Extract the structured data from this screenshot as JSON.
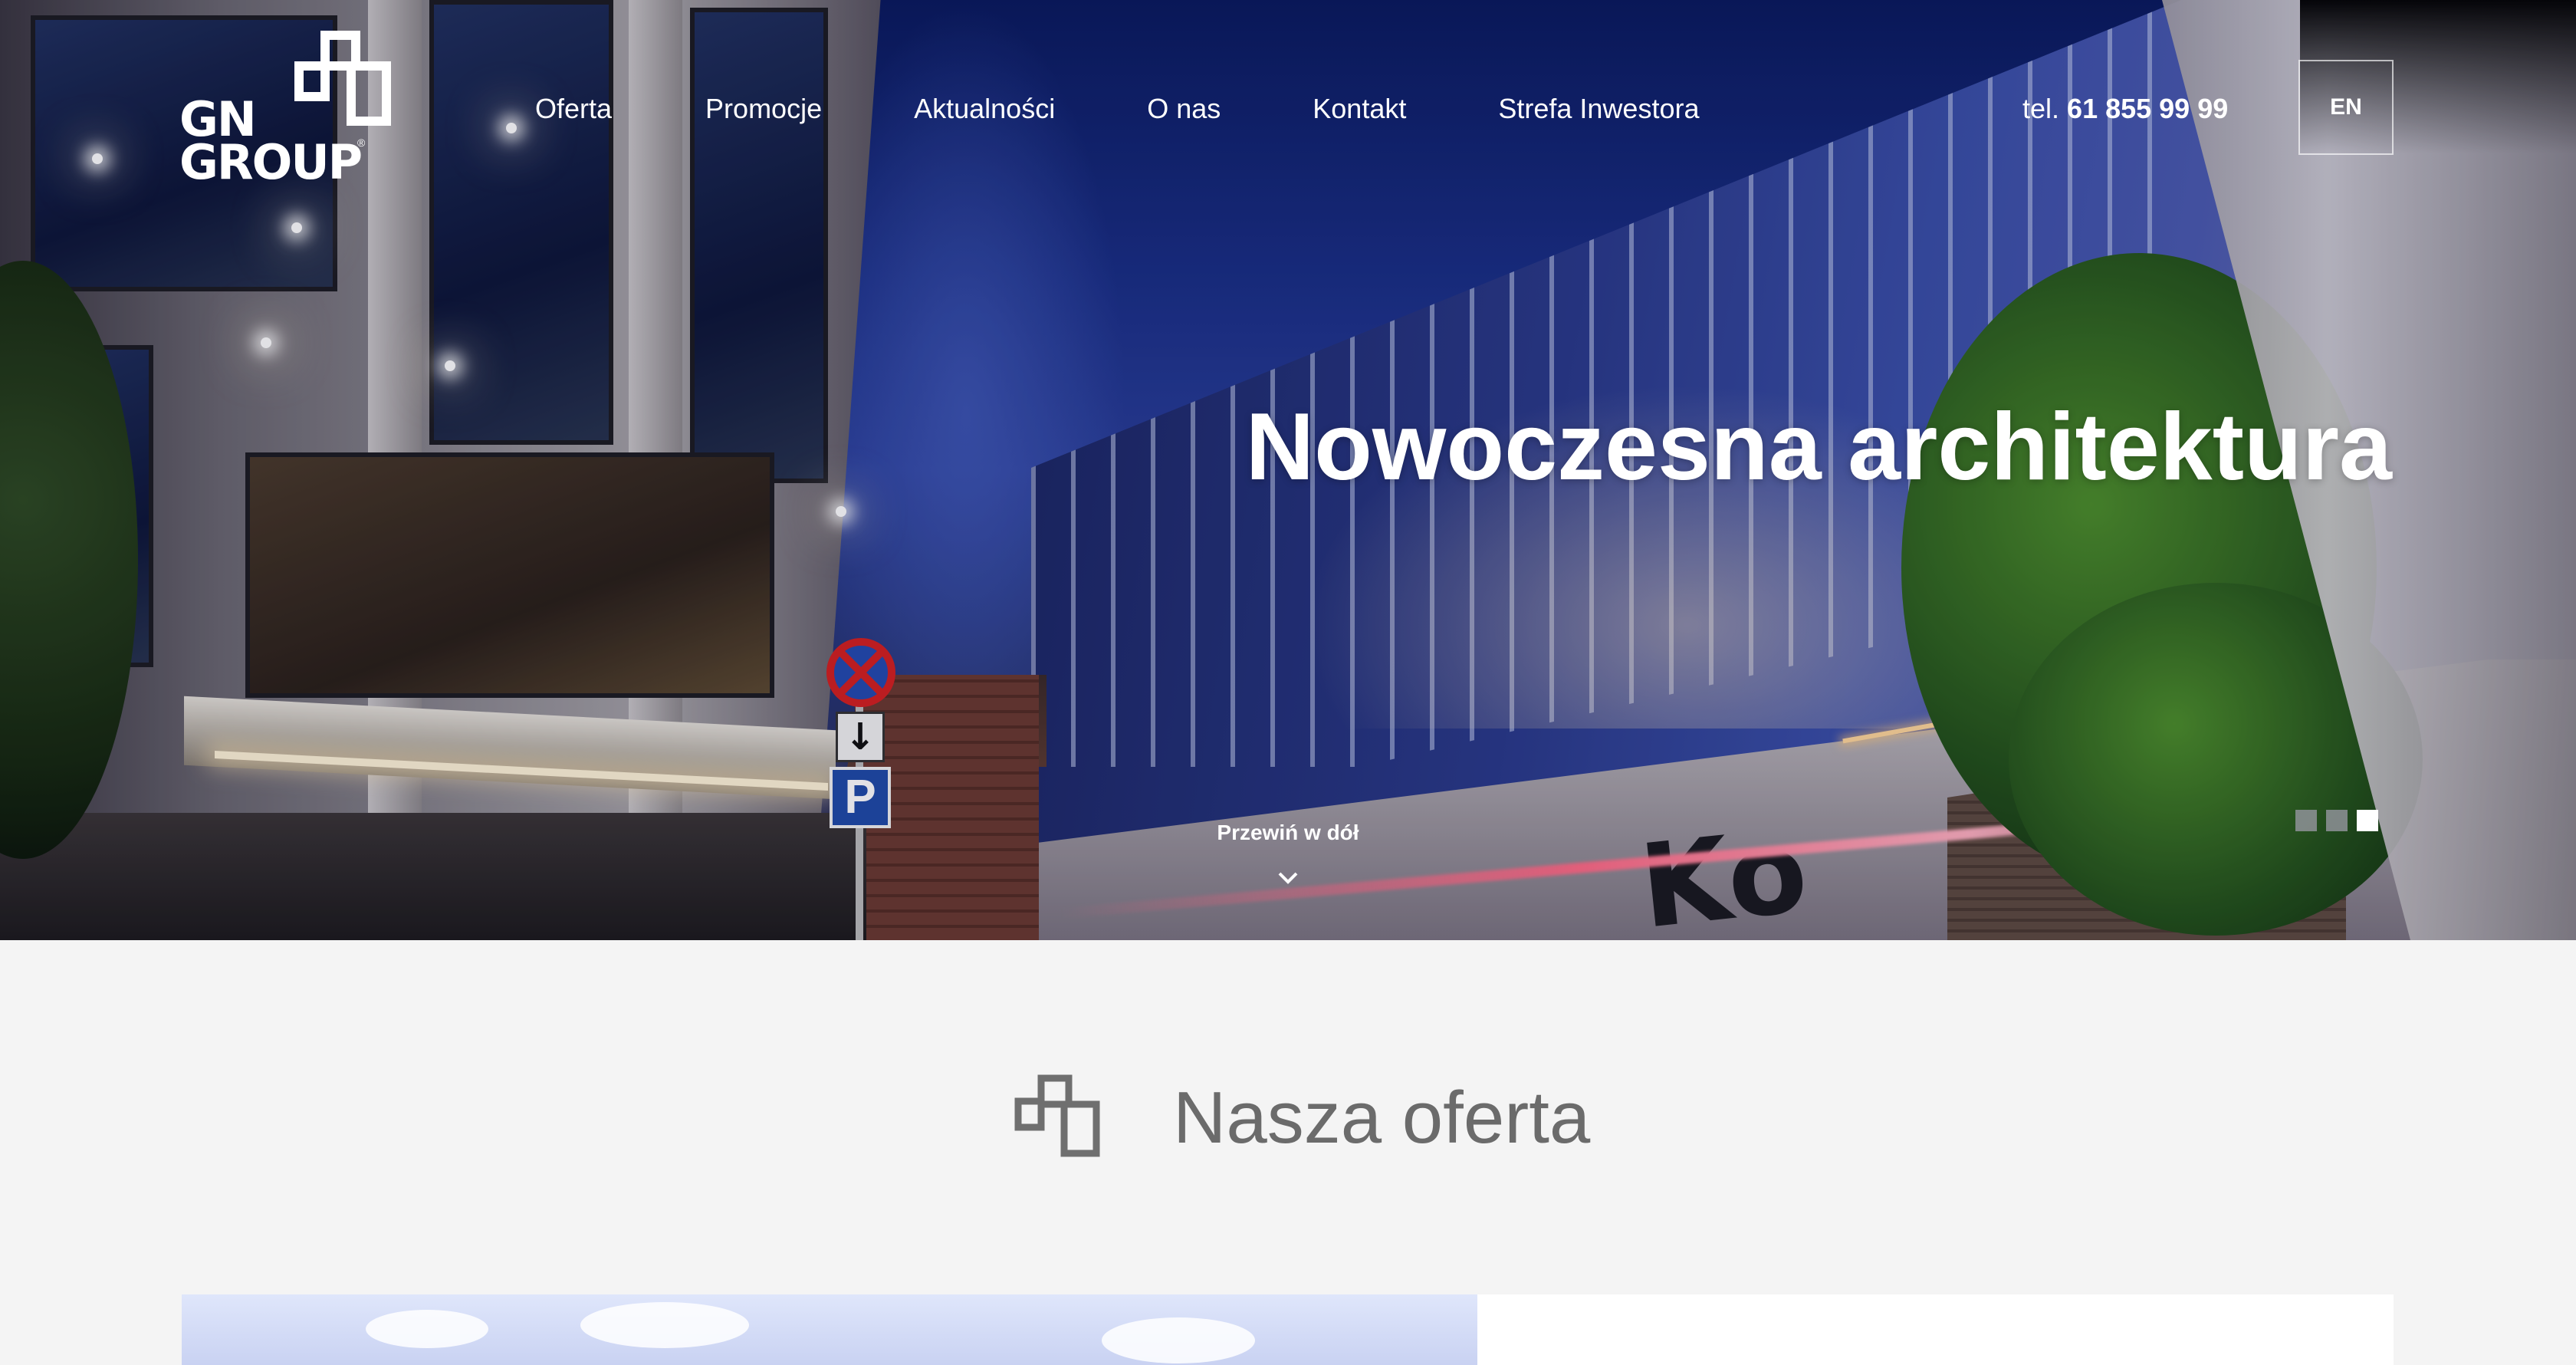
{
  "brand": {
    "logo_line1": "GN",
    "logo_line2": "GROUP",
    "logo_mark": "®"
  },
  "nav": {
    "items": [
      {
        "label": "Oferta"
      },
      {
        "label": "Promocje"
      },
      {
        "label": "Aktualności"
      },
      {
        "label": "O nas"
      },
      {
        "label": "Kontakt"
      },
      {
        "label": "Strefa Inwestora"
      }
    ]
  },
  "contact": {
    "phone_prefix": "tel.",
    "phone_number": "61 855 99 99"
  },
  "language": {
    "label": "EN"
  },
  "hero": {
    "headline": "Nowoczesna architektura",
    "scroll_label": "Przewiń w dół",
    "slides_total": 3,
    "active_slide": 3
  },
  "offer": {
    "title": "Nasza oferta"
  },
  "colors": {
    "accent_white": "#ffffff",
    "section_bg": "#f4f4f4",
    "title_gray": "#6b6b6b",
    "icon_gray": "#6f6f6f"
  },
  "icons": {
    "brand": "gn-group-logo-icon",
    "offer": "offer-blocks-icon",
    "scroll": "chevron-down-icon"
  }
}
